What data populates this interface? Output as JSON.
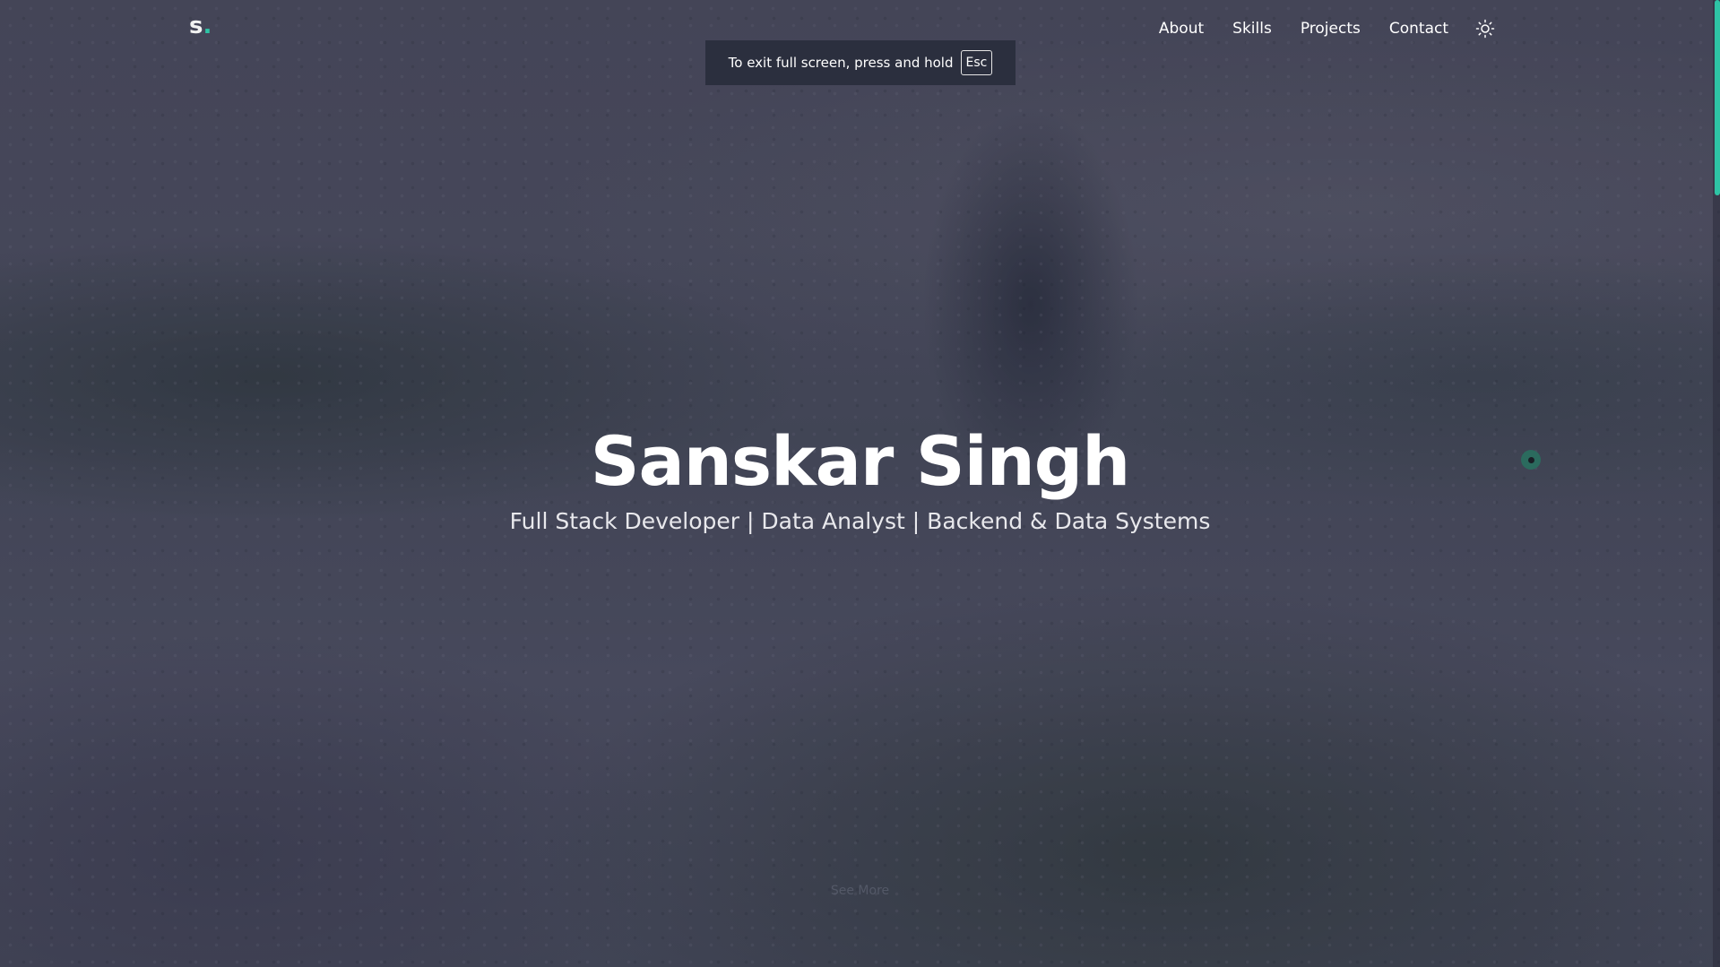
{
  "brand": {
    "letter": "s",
    "dot": "."
  },
  "nav": {
    "items": [
      {
        "label": "About"
      },
      {
        "label": "Skills"
      },
      {
        "label": "Projects"
      },
      {
        "label": "Contact"
      }
    ],
    "theme_toggle_icon": "sun-icon"
  },
  "fullscreen_notice": {
    "text": "To exit full screen, press and hold",
    "key": "Esc"
  },
  "hero": {
    "title": "Sanskar Singh",
    "subtitle": "Full Stack Developer | Data Analyst | Backend & Data Systems",
    "see_more": "See More"
  },
  "colors": {
    "accent": "#2ec4a5",
    "background": "#4a4a5c",
    "toast": "#2b2f3e"
  }
}
